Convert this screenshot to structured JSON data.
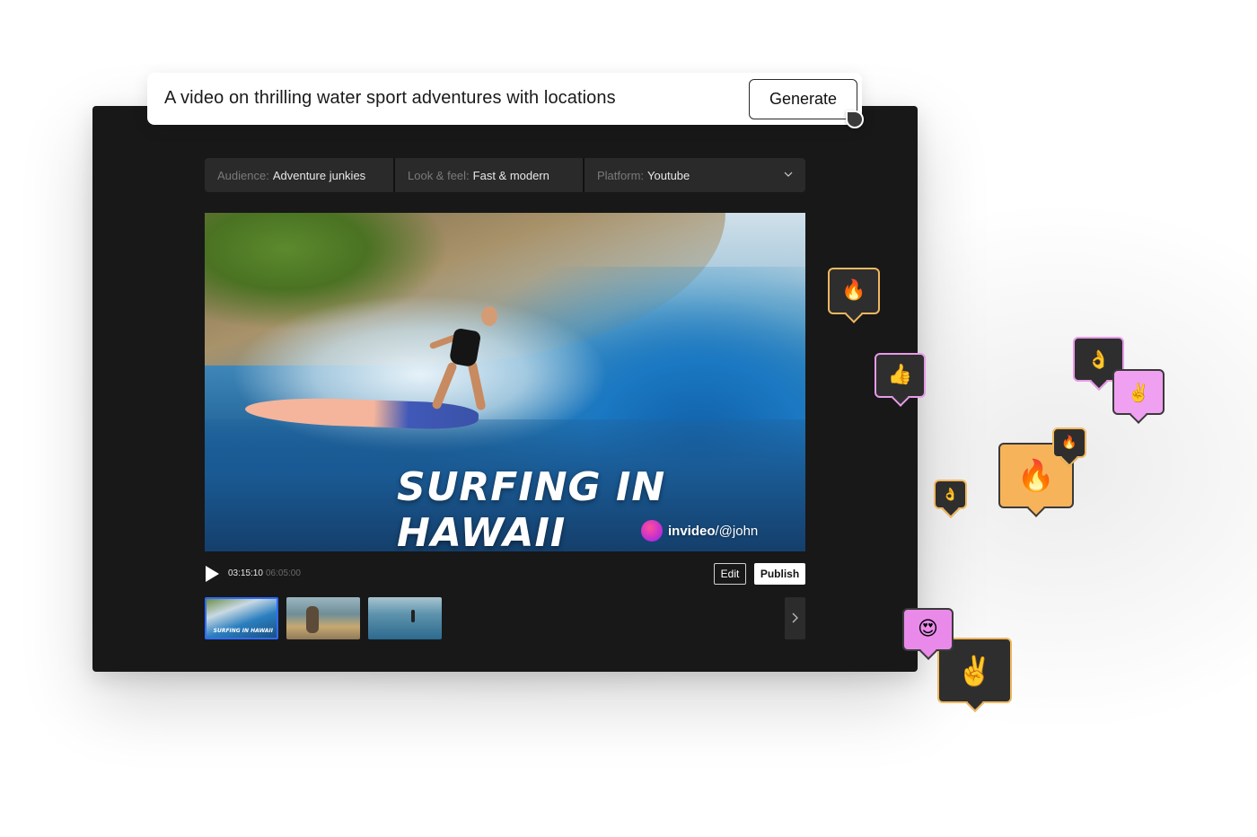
{
  "prompt": {
    "text": "A video on thrilling water sport adventures with locations",
    "generate_label": "Generate"
  },
  "options": [
    {
      "key": "Audience:",
      "value": "Adventure junkies"
    },
    {
      "key": "Look & feel:",
      "value": "Fast & modern"
    },
    {
      "key": "Platform:",
      "value": "Youtube"
    }
  ],
  "video": {
    "title": "SURFING IN HAWAII",
    "credit_brand": "invideo",
    "credit_handle": "/@john"
  },
  "player": {
    "current_time": "03:15:10",
    "total_time": "06:05:00",
    "edit_label": "Edit",
    "publish_label": "Publish"
  },
  "thumbnails": [
    {
      "caption": "SURFING IN HAWAII",
      "selected": true
    },
    {
      "caption": "",
      "selected": false
    },
    {
      "caption": "",
      "selected": false
    }
  ],
  "reactions": [
    {
      "emoji": "🔥",
      "icon": "fire-icon"
    },
    {
      "emoji": "👍",
      "icon": "thumbs-up-icon"
    },
    {
      "emoji": "👌",
      "icon": "ok-hand-icon"
    },
    {
      "emoji": "✌️",
      "icon": "victory-hand-icon"
    },
    {
      "emoji": "🔥",
      "icon": "fire-icon"
    },
    {
      "emoji": "🔥",
      "icon": "fire-icon"
    },
    {
      "emoji": "👌",
      "icon": "ok-hand-icon"
    },
    {
      "emoji": "😍",
      "icon": "heart-eyes-icon"
    },
    {
      "emoji": "✌️",
      "icon": "victory-hand-icon"
    }
  ],
  "colors": {
    "panel_bg": "#181818",
    "selected_thumb_border": "#2f6bff",
    "bubble_gold": "#f0b860",
    "bubble_pink": "#e89ae8",
    "bubble_orange": "#f7b35a"
  }
}
